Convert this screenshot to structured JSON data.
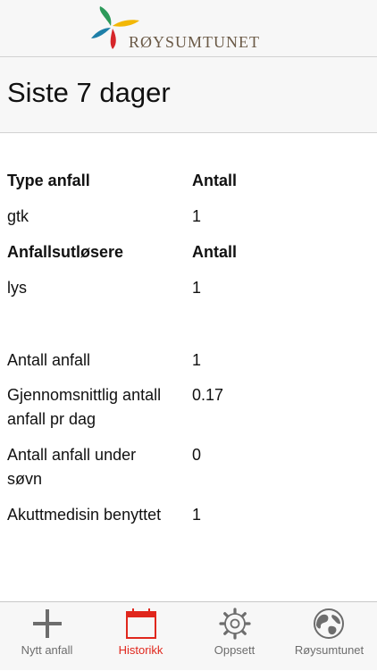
{
  "header": {
    "logo_text": "RØYSUMTUNET"
  },
  "page": {
    "title": "Siste 7 dager"
  },
  "stats": {
    "type_header": "Type anfall",
    "type_count_header": "Antall",
    "types": [
      {
        "name": "gtk",
        "count": "1"
      }
    ],
    "triggers_header": "Anfallsutløsere",
    "triggers_count_header": "Antall",
    "triggers": [
      {
        "name": "lys",
        "count": "1"
      }
    ],
    "summary": [
      {
        "label": "Antall anfall",
        "value": "1"
      },
      {
        "label": "Gjennomsnittlig antall anfall pr dag",
        "value": "0.17"
      },
      {
        "label": "Antall anfall under søvn",
        "value": "0"
      },
      {
        "label": "Akuttmedisin benyttet",
        "value": "1"
      }
    ]
  },
  "tabbar": {
    "active_color": "#e0271d",
    "inactive_color": "#6d6d6d",
    "items": [
      {
        "label": "Nytt anfall",
        "icon": "plus-icon",
        "active": false
      },
      {
        "label": "Historikk",
        "icon": "calendar-icon",
        "active": true
      },
      {
        "label": "Oppsett",
        "icon": "gear-icon",
        "active": false
      },
      {
        "label": "Røysumtunet",
        "icon": "globe-icon",
        "active": false
      }
    ]
  }
}
